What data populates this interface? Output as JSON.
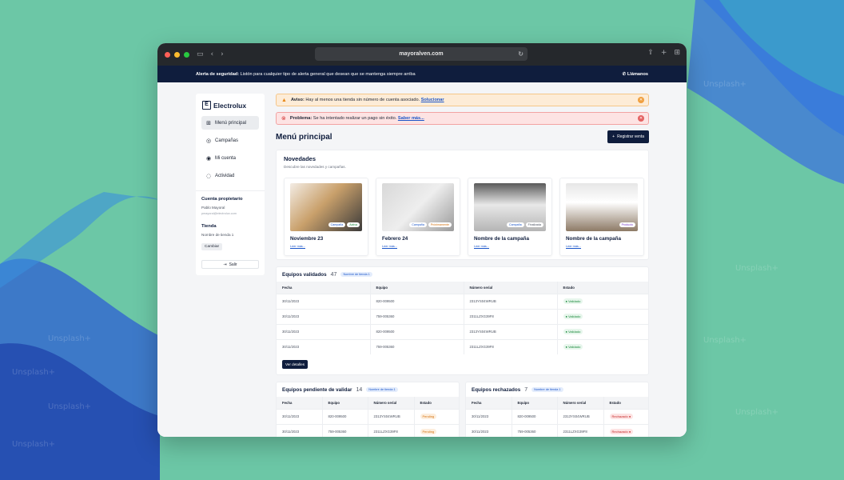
{
  "browser": {
    "url": "mayoralven.com"
  },
  "top_alert": {
    "label": "Alerta de seguridad:",
    "text": "Listón para cualquier tipo de alerta general que desean que se mantenga siempre arriba",
    "call": "Llámanos"
  },
  "sidebar": {
    "brand": "Electrolux",
    "items": [
      {
        "label": "Menú principal"
      },
      {
        "label": "Campañas"
      },
      {
        "label": "Mi cuenta"
      },
      {
        "label": "Actividad"
      }
    ],
    "owner_title": "Cuenta propietario",
    "owner_name": "Pablo Mayoral",
    "owner_email": "pmayoral@electrolux.com",
    "store_title": "Tienda",
    "store_name": "Nombre de tienda 1",
    "change": "Cambiar",
    "logout": "Salir"
  },
  "notices": {
    "warn_label": "Aviso:",
    "warn_text": "Hay al menos una tienda sin número de cuenta asociado.",
    "warn_link": "Solucionar",
    "err_label": "Problema:",
    "err_text": "Se ha intentado realizar un pago sin éxito.",
    "err_link": "Saber más..."
  },
  "page": {
    "title": "Menú principal",
    "register": "Registrar venta"
  },
  "novedades": {
    "title": "Novedades",
    "subtitle": "Descubre las novedades y campañas.",
    "cards": [
      {
        "title": "Noviembre 23",
        "link": "Leer más...",
        "tags": [
          "Campaña",
          "Activa"
        ]
      },
      {
        "title": "Febrero 24",
        "link": "Leer más...",
        "tags": [
          "Campaña",
          "Próximamente"
        ]
      },
      {
        "title": "Nombre de la campaña",
        "link": "Leer más...",
        "tags": [
          "Campaña",
          "Finalizada"
        ]
      },
      {
        "title": "Nombre de la campaña",
        "link": "Leer más...",
        "tags": [
          "Producto"
        ]
      }
    ]
  },
  "validados": {
    "title": "Equipos validados",
    "count": "47",
    "badge": "Nombre de tienda 1",
    "headers": [
      "Fecha",
      "Equipo",
      "Número serial",
      "Estado"
    ],
    "rows": [
      [
        "30/11/2023",
        "820-009500",
        "2313YS04WRUB",
        "Validado"
      ],
      [
        "30/11/2023",
        "759-005360",
        "2311LZXG39F8",
        "Validado"
      ],
      [
        "30/11/2023",
        "820-009500",
        "2313YS04WRUB",
        "Validado"
      ],
      [
        "30/11/2023",
        "759-005360",
        "2311LZXG39F8",
        "Validado"
      ]
    ],
    "button": "Ver detalles"
  },
  "pendiente": {
    "title": "Equipos pendiente de validar",
    "count": "14",
    "badge": "Nombre de tienda 1",
    "headers": [
      "Fecha",
      "Equipo",
      "Número serial",
      "Estado"
    ],
    "rows": [
      [
        "30/11/2023",
        "820-009500",
        "2313YS04WRUB",
        "Pending"
      ],
      [
        "30/11/2023",
        "759-005360",
        "2311LZXG39F8",
        "Pending"
      ]
    ]
  },
  "rechazados": {
    "title": "Equipos rechazados",
    "count": "7",
    "badge": "Nombre de tienda 1",
    "headers": [
      "Fecha",
      "Equipo",
      "Número serial",
      "Estado"
    ],
    "rows": [
      [
        "30/11/2023",
        "820-009500",
        "2313YS04WRUB",
        "Rechazado"
      ],
      [
        "30/11/2023",
        "759-005360",
        "2311LZXG39F8",
        "Rechazado"
      ]
    ]
  },
  "watermark": "Unsplash+"
}
